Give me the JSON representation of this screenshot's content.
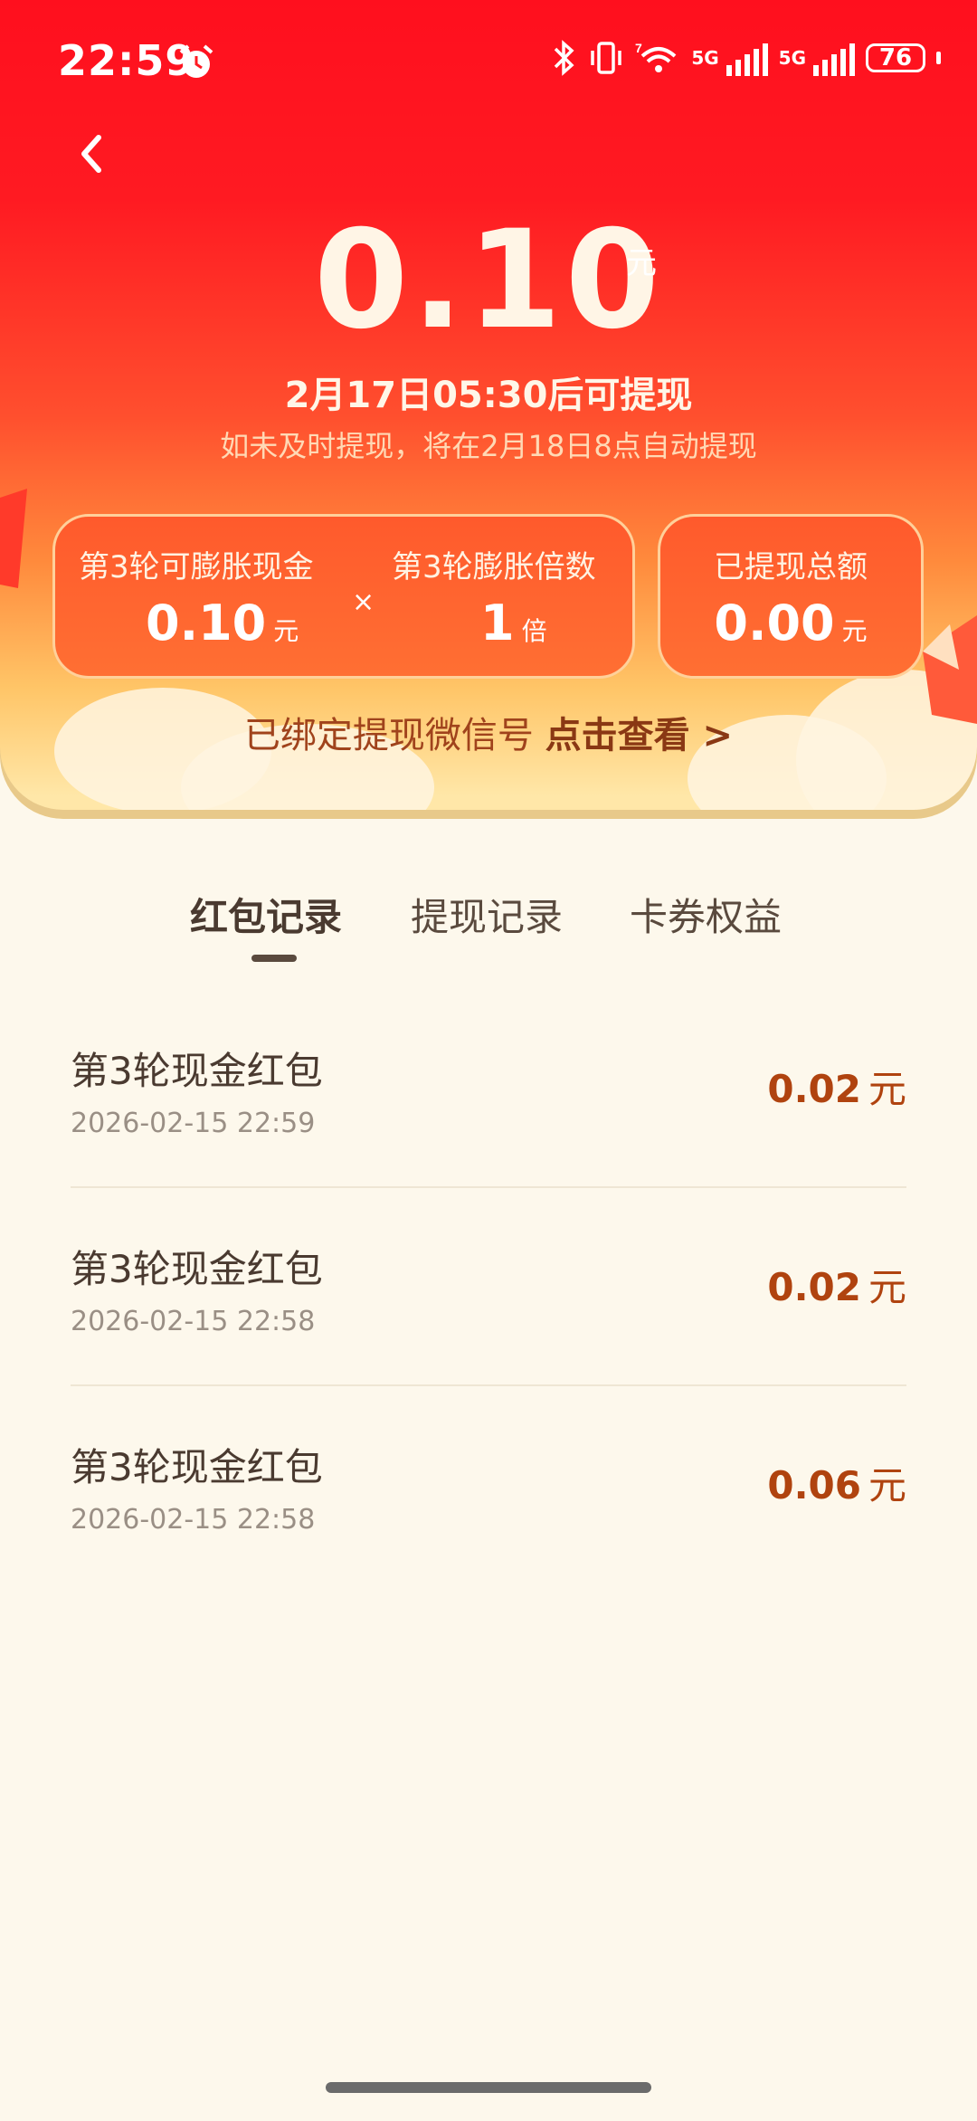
{
  "status_bar": {
    "time": "22:59",
    "battery": "76"
  },
  "header": {
    "amount": "0.10",
    "amount_unit": "元",
    "withdraw_time": "2月17日05:30后可提现",
    "auto_withdraw_note": "如未及时提现，将在2月18日8点自动提现"
  },
  "cards": {
    "expandable_cash_label": "第3轮可膨胀现金",
    "expandable_cash_value": "0.10",
    "expandable_cash_unit": "元",
    "times_symbol": "×",
    "multiplier_label": "第3轮膨胀倍数",
    "multiplier_value": "1",
    "multiplier_unit": "倍",
    "withdrawn_total_label": "已提现总额",
    "withdrawn_total_value": "0.00",
    "withdrawn_total_unit": "元"
  },
  "bind_wechat": {
    "text": "已绑定提现微信号",
    "link": "点击查看 >"
  },
  "tabs": [
    {
      "label": "红包记录"
    },
    {
      "label": "提现记录"
    },
    {
      "label": "卡券权益"
    }
  ],
  "records": [
    {
      "title": "第3轮现金红包",
      "time": "2026-02-15 22:59",
      "amount": "0.02",
      "unit": "元"
    },
    {
      "title": "第3轮现金红包",
      "time": "2026-02-15 22:58",
      "amount": "0.02",
      "unit": "元"
    },
    {
      "title": "第3轮现金红包",
      "time": "2026-02-15 22:58",
      "amount": "0.06",
      "unit": "元"
    }
  ],
  "colors": {
    "hero_top": "#ff0f1e",
    "accent_amount": "#b0430f",
    "page_bg": "#fdf8ec"
  }
}
